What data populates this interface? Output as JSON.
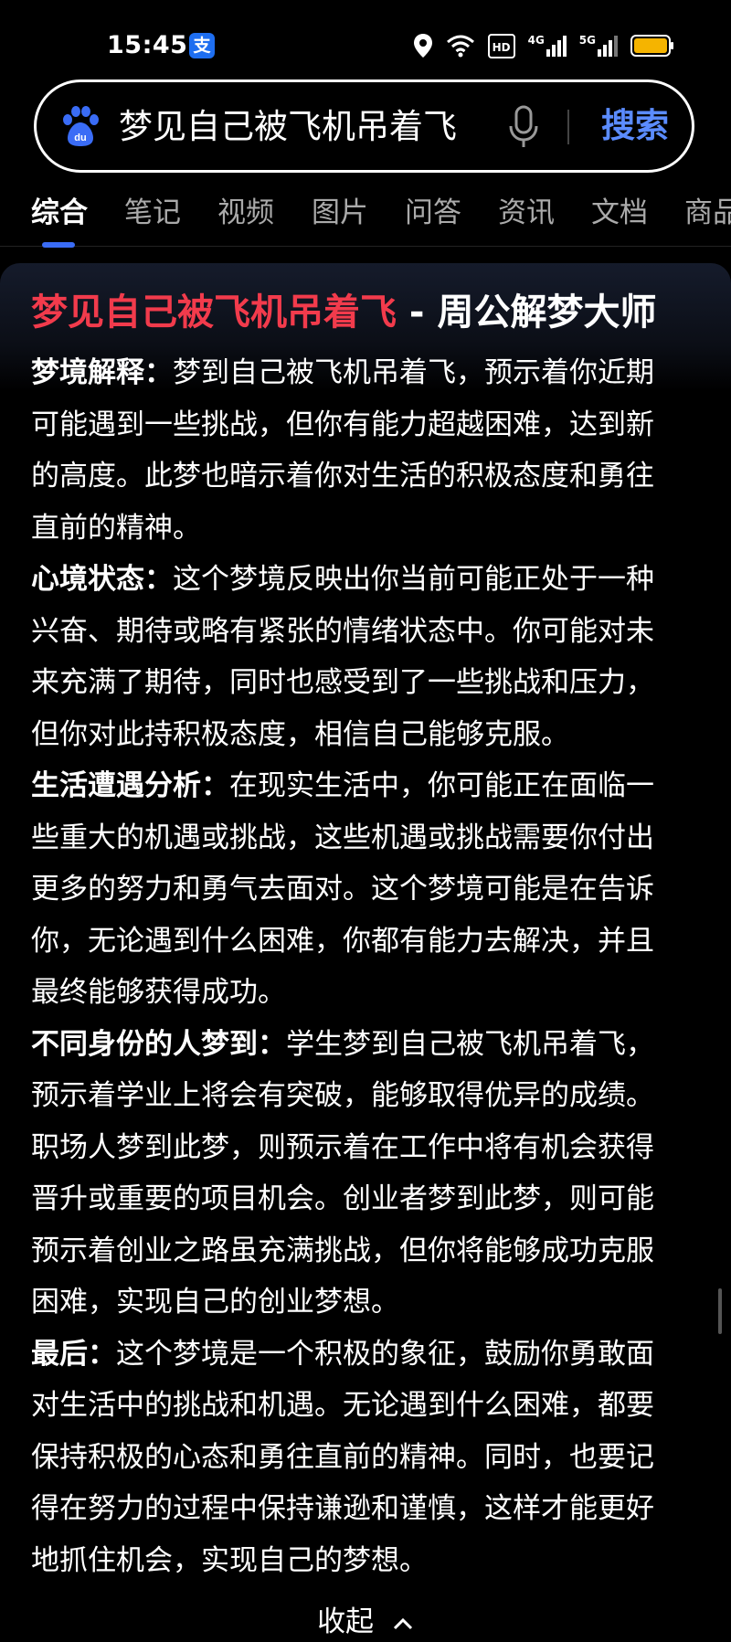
{
  "status_bar": {
    "time": "15:45",
    "alipay_glyph": "支",
    "hd_label": "HD",
    "net1": "4G",
    "net2": "5G"
  },
  "search": {
    "query": "梦见自己被飞机吊着飞",
    "button_label": "搜索"
  },
  "tabs": [
    "综合",
    "笔记",
    "视频",
    "图片",
    "问答",
    "资讯",
    "文档",
    "商品"
  ],
  "active_tab": "综合",
  "card": {
    "title_highlight": "梦见自己被飞机吊着飞",
    "title_rest": " - 周公解梦大师",
    "sections": [
      {
        "label": "梦境解释：",
        "text": "梦到自己被飞机吊着飞，预示着你近期可能遇到一些挑战，但你有能力超越困难，达到新的高度。此梦也暗示着你对生活的积极态度和勇往直前的精神。"
      },
      {
        "label": "心境状态：",
        "text": "这个梦境反映出你当前可能正处于一种兴奋、期待或略有紧张的情绪状态中。你可能对未来充满了期待，同时也感受到了一些挑战和压力，但你对此持积极态度，相信自己能够克服。"
      },
      {
        "label": "生活遭遇分析：",
        "text": "在现实生活中，你可能正在面临一些重大的机遇或挑战，这些机遇或挑战需要你付出更多的努力和勇气去面对。这个梦境可能是在告诉你，无论遇到什么困难，你都有能力去解决，并且最终能够获得成功。"
      },
      {
        "label": "不同身份的人梦到：",
        "text": "学生梦到自己被飞机吊着飞，预示着学业上将会有突破，能够取得优异的成绩。职场人梦到此梦，则预示着在工作中将有机会获得晋升或重要的项目机会。创业者梦到此梦，则可能预示着创业之路虽充满挑战，但你将能够成功克服困难，实现自己的创业梦想。"
      },
      {
        "label": "最后：",
        "text": "这个梦境是一个积极的象征，鼓励你勇敢面对生活中的挑战和机遇。无论遇到什么困难，都要保持积极的心态和勇往直前的精神。同时，也要记得在努力的过程中保持谦逊和谨慎，这样才能更好地抓住机会，实现自己的梦想。"
      }
    ],
    "collapse_label": "收起"
  },
  "icons": {
    "logo": "baidu-paw-icon",
    "mic": "microphone-icon",
    "location": "location-icon",
    "wifi": "wifi-icon",
    "battery": "battery-icon",
    "collapse": "chevron-up-icon"
  },
  "colors": {
    "accent_blue": "#5b8cff",
    "title_red": "#f23b4c",
    "battery_yellow": "#f5b400"
  }
}
